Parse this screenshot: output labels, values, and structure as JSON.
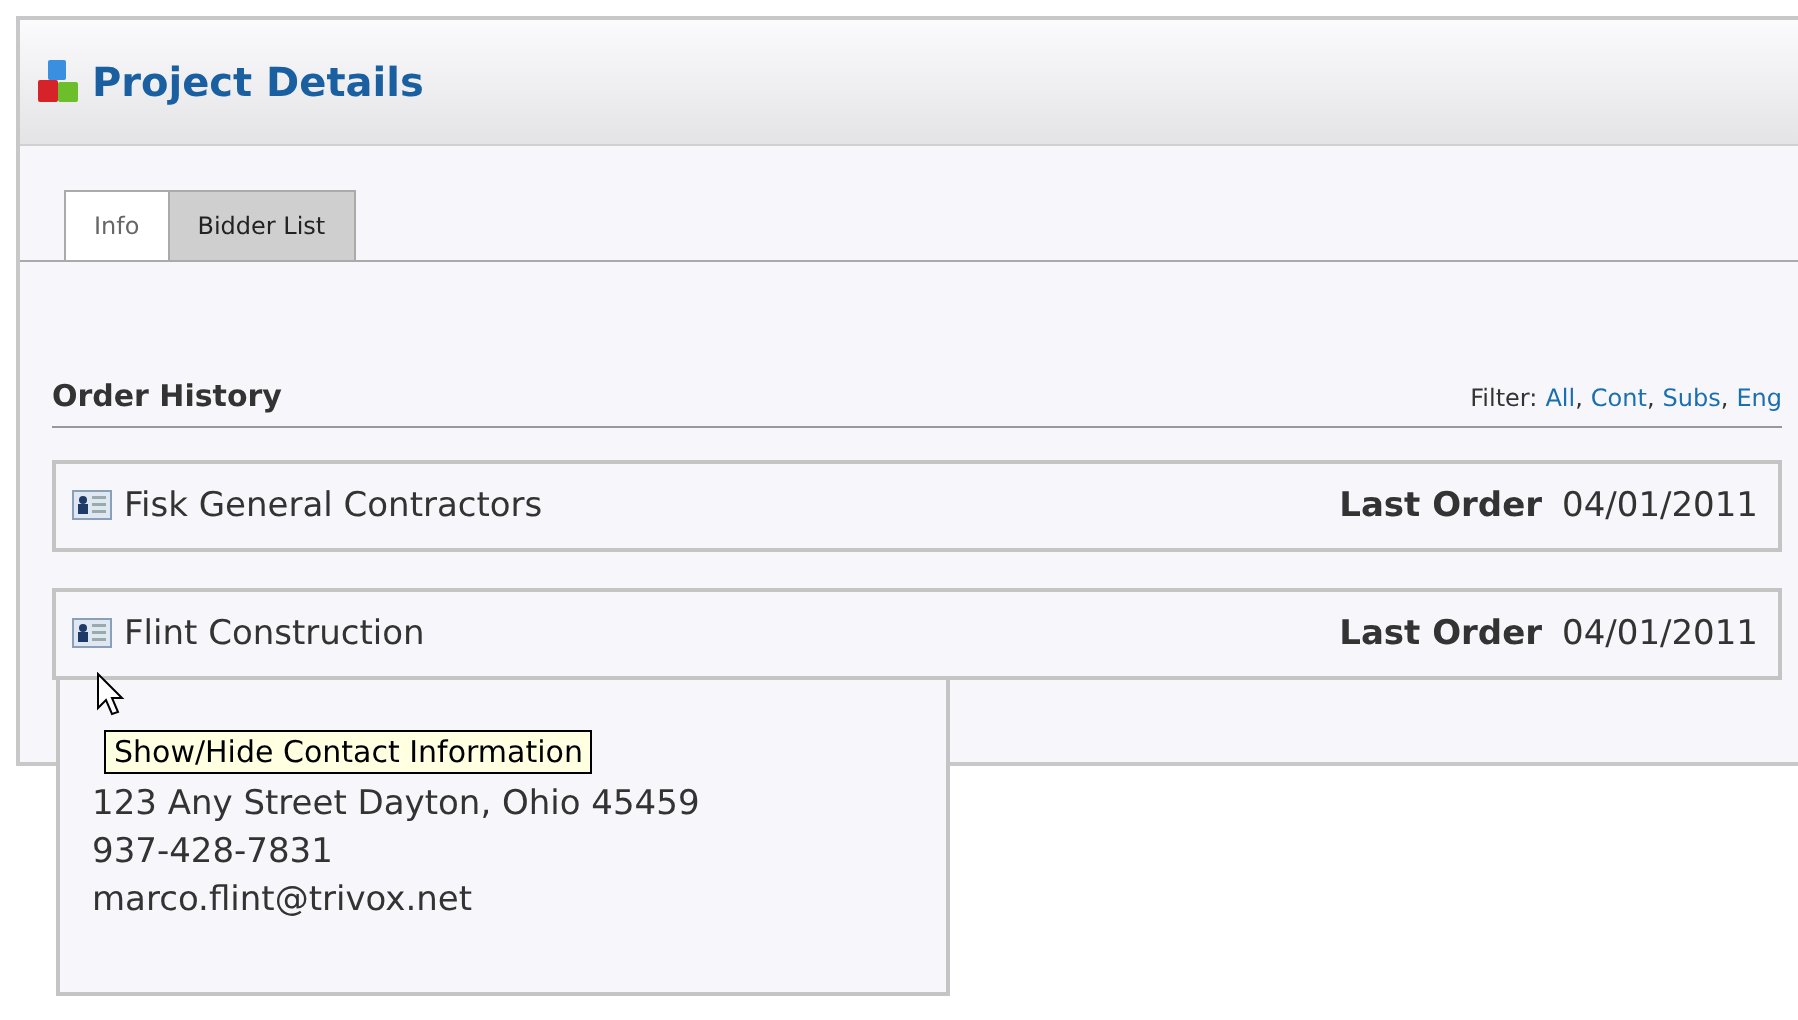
{
  "window": {
    "title": "Project Details"
  },
  "tabs": [
    {
      "label": "Info",
      "selected": true
    },
    {
      "label": "Bidder List",
      "selected": false
    }
  ],
  "section": {
    "title": "Order History",
    "filter_label": "Filter:",
    "filters": [
      "All",
      "Cont",
      "Subs",
      "Eng"
    ],
    "separator": ","
  },
  "rows": [
    {
      "name": "Fisk General Contractors",
      "last_order_label": "Last Order",
      "last_order_date": "04/01/2011",
      "expanded": false
    },
    {
      "name": "Flint Construction",
      "last_order_label": "Last Order",
      "last_order_date": "04/01/2011",
      "expanded": true,
      "contact": [
        "123 Any Street Dayton, Ohio 45459",
        "937-428-7831",
        "marco.flint@trivox.net"
      ]
    }
  ],
  "tooltip": "Show/Hide Contact Information"
}
